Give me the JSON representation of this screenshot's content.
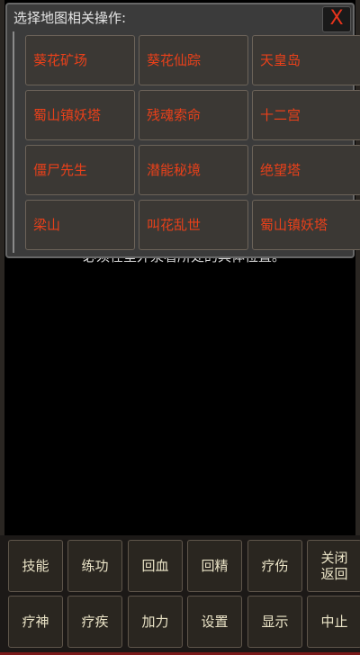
{
  "background_text": "必须在室外泉看所处的具体位置。",
  "dialog": {
    "title": "选择地图相关操作:",
    "close_label": "X",
    "maps": [
      "葵花矿场",
      "葵花仙踪",
      "天皇岛",
      "蜀山镇妖塔",
      "残魂索命",
      "十二宫",
      "僵尸先生",
      "潜能秘境",
      "绝望塔",
      "梁山",
      "叫花乱世",
      "蜀山镇妖塔"
    ]
  },
  "actions": {
    "row1": [
      "技能",
      "练功",
      "回血",
      "回精",
      "疗伤",
      "关闭返回"
    ],
    "row2": [
      "疗神",
      "疗疾",
      "加力",
      "设置",
      "显示",
      "中止"
    ],
    "close_line1": "关闭",
    "close_line2": "返回"
  },
  "colors": {
    "map_text": "#e8401a",
    "close_x": "#e8341c",
    "action_text": "#ece5c8"
  }
}
